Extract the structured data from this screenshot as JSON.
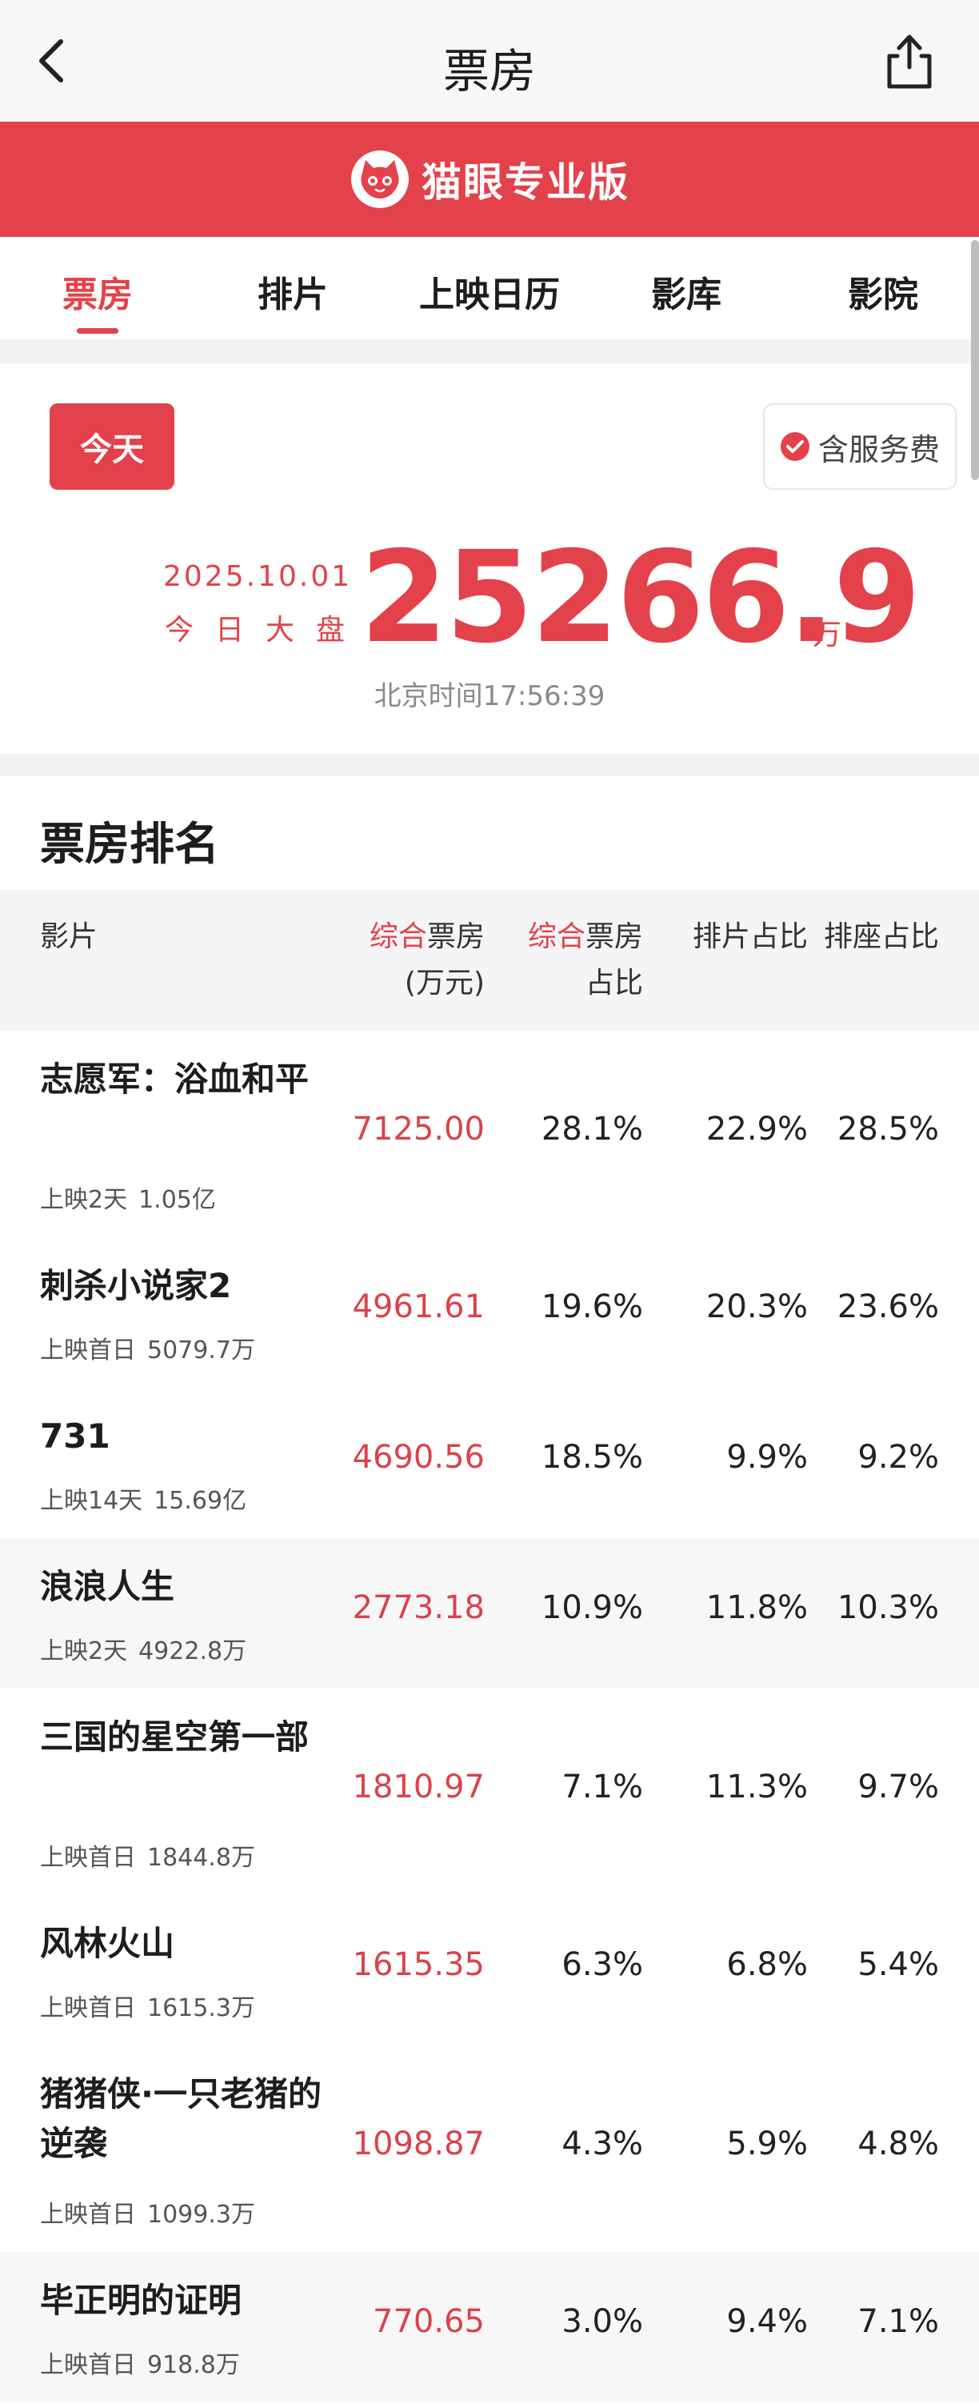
{
  "header": {
    "title": "票房"
  },
  "banner": {
    "brand": "猫眼专业版"
  },
  "tabs": [
    "票房",
    "排片",
    "上映日历",
    "影库",
    "影院"
  ],
  "summary": {
    "today_label": "今天",
    "fee_label": "含服务费",
    "date": "2025.10.01",
    "market_label": "今日大盘",
    "total": "25266.9",
    "unit": "万",
    "time": "北京时间17:56:39"
  },
  "ranking": {
    "title": "票房排名",
    "headers": {
      "film": "影片",
      "bo_prefix": "综合",
      "bo_main": "票房",
      "bo_unit": "(万元)",
      "share_prefix": "综合",
      "share_main": "票房",
      "share_line2": "占比",
      "sched": "排片占比",
      "seat": "排座占比"
    },
    "rows": [
      {
        "name": "志愿军：浴血和平",
        "days": "上映2天",
        "cumulative": "1.05亿",
        "box_office": "7125.00",
        "share": "28.1%",
        "schedule": "22.9%",
        "seat": "28.5%"
      },
      {
        "name": "刺杀小说家2",
        "days": "上映首日",
        "cumulative": "5079.7万",
        "box_office": "4961.61",
        "share": "19.6%",
        "schedule": "20.3%",
        "seat": "23.6%"
      },
      {
        "name": "731",
        "days": "上映14天",
        "cumulative": "15.69亿",
        "box_office": "4690.56",
        "share": "18.5%",
        "schedule": "9.9%",
        "seat": "9.2%"
      },
      {
        "name": "浪浪人生",
        "days": "上映2天",
        "cumulative": "4922.8万",
        "box_office": "2773.18",
        "share": "10.9%",
        "schedule": "11.8%",
        "seat": "10.3%"
      },
      {
        "name": "三国的星空第一部",
        "days": "上映首日",
        "cumulative": "1844.8万",
        "box_office": "1810.97",
        "share": "7.1%",
        "schedule": "11.3%",
        "seat": "9.7%"
      },
      {
        "name": "风林火山",
        "days": "上映首日",
        "cumulative": "1615.3万",
        "box_office": "1615.35",
        "share": "6.3%",
        "schedule": "6.8%",
        "seat": "5.4%"
      },
      {
        "name": "猪猪侠·一只老猪的逆袭",
        "days": "上映首日",
        "cumulative": "1099.3万",
        "box_office": "1098.87",
        "share": "4.3%",
        "schedule": "5.9%",
        "seat": "4.8%"
      },
      {
        "name": "毕正明的证明",
        "days": "上映首日",
        "cumulative": "918.8万",
        "box_office": "770.65",
        "share": "3.0%",
        "schedule": "9.4%",
        "seat": "7.1%"
      }
    ]
  },
  "colors": {
    "accent": "#e3424a",
    "page_bg": "#f2f2f4"
  }
}
